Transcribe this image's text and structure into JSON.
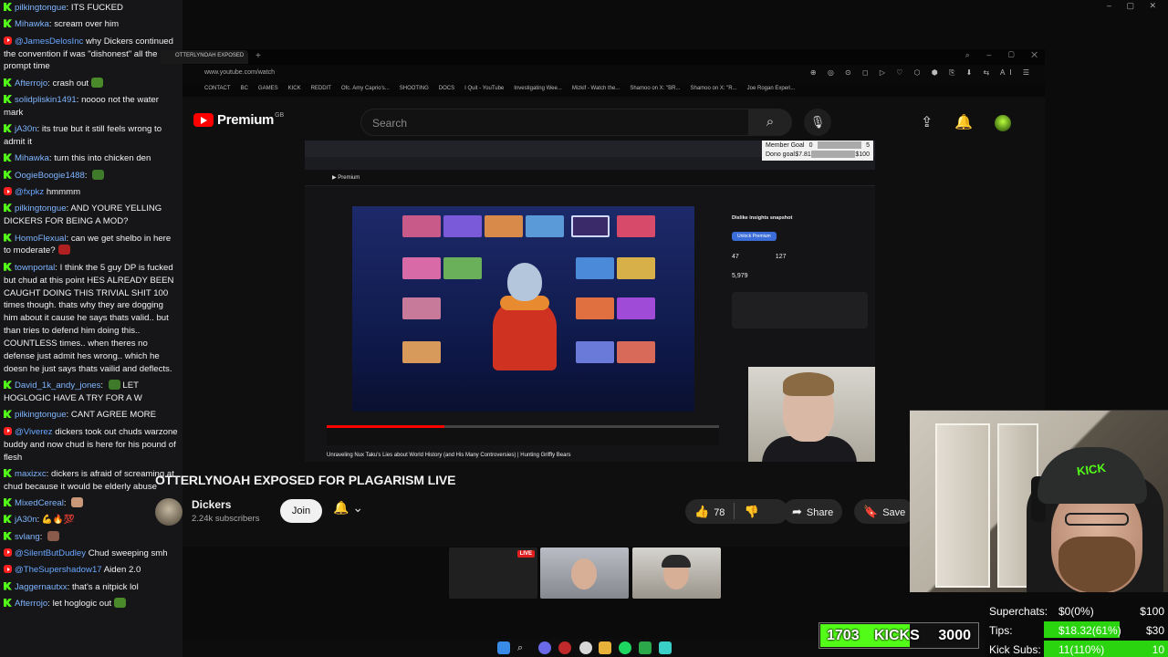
{
  "chat": {
    "messages": [
      {
        "badge": "kick",
        "user": "pilkingtongue",
        "color": "#7fb5ff",
        "text": "ITS FUCKED"
      },
      {
        "badge": "kick",
        "user": "Mihawka",
        "color": "#7fb5ff",
        "text": "scream over him"
      },
      {
        "badge": "yt",
        "user": "@JamesDelosInc",
        "color": "#6aa7ff",
        "text": "why Dickers continued the convention if was \"dishonest\" all the prompt time"
      },
      {
        "badge": "kick",
        "user": "Afterrojo",
        "color": "#7fb5ff",
        "text": "crash out",
        "emote": "#4a8a2a"
      },
      {
        "badge": "kick",
        "user": "solidpliskin1491",
        "color": "#7fb5ff",
        "text": "noooo not the water mark"
      },
      {
        "badge": "kick",
        "user": "jA30n",
        "color": "#7fb5ff",
        "text": "its true but it still feels wrong to admit it"
      },
      {
        "badge": "kick",
        "user": "Mihawka",
        "color": "#7fb5ff",
        "text": "turn this into chicken den"
      },
      {
        "badge": "kick",
        "user": "OogieBoogie1488",
        "color": "#7fb5ff",
        "text": "",
        "emote": "#3e7a2a"
      },
      {
        "badge": "yt",
        "user": "@fxpkz",
        "color": "#6aa7ff",
        "text": "hmmmm"
      },
      {
        "badge": "kick",
        "user": "pilkingtongue",
        "color": "#7fb5ff",
        "text": "AND YOURE YELLING DICKERS FOR BEING A MOD?"
      },
      {
        "badge": "kick",
        "user": "HomoFlexual",
        "color": "#7fb5ff",
        "text": "can we get shelbo in here to moderate?",
        "emote": "#b02020"
      },
      {
        "badge": "kick",
        "user": "townportal",
        "color": "#7fb5ff",
        "text": "I think the 5 guy DP is fucked but chud at this point HES ALREADY BEEN CAUGHT DOING THIS TRIVIAL SHIT 100 times though. thats why they are dogging him about it cause he says thats valid.. but than tries to defend him doing this.. COUNTLESS times.. when theres no defense just admit hes wrong.. which he doesn he just says thats vailid and deflects."
      },
      {
        "badge": "kick",
        "user": "David_1k_andy_jones",
        "color": "#7fb5ff",
        "text": "LET HOGLOGIC HAVE A TRY FOR A W",
        "emote": "#3e7a2a",
        "emote_first": true
      },
      {
        "badge": "kick",
        "user": "pilkingtongue",
        "color": "#7fb5ff",
        "text": "CANT AGREE MORE"
      },
      {
        "badge": "yt",
        "user": "@Viverez",
        "color": "#6aa7ff",
        "text": "dickers took out chuds warzone buddy and now chud is here for his pound of flesh"
      },
      {
        "badge": "kick",
        "user": "maxizxc",
        "color": "#7fb5ff",
        "text": "dickers is afraid of screaming at chud because it would be elderly abuse"
      },
      {
        "badge": "kick",
        "user": "MixedCereal",
        "color": "#7fb5ff",
        "text": "",
        "emote": "#c89878"
      },
      {
        "badge": "kick",
        "user": "jA30n",
        "color": "#7fb5ff",
        "text": "💪🔥💯"
      },
      {
        "badge": "kick",
        "user": "svlang",
        "color": "#7fb5ff",
        "text": "",
        "emote": "#8a5a4a"
      },
      {
        "badge": "yt",
        "user": "@SilentButDudley",
        "color": "#6aa7ff",
        "text": "Chud sweeping smh"
      },
      {
        "badge": "yt",
        "user": "@TheSupershadow17",
        "color": "#6aa7ff",
        "text": "Aiden 2.0"
      },
      {
        "badge": "kick",
        "user": "Jaggernautxx",
        "color": "#7fb5ff",
        "text": "that's a nitpick lol"
      },
      {
        "badge": "kick",
        "user": "Afterrojo",
        "color": "#7fb5ff",
        "text": "let hoglogic out",
        "emote": "#4a8a2a"
      }
    ]
  },
  "browser": {
    "tab_label": "OTTERLYNOAH EXPOSED",
    "url": "www.youtube.com/watch",
    "bookmarks": [
      "CONTACT",
      "BC",
      "GAMES",
      "KICK",
      "REDDIT",
      "Ofc. Amy Caprio's...",
      "SHOOTING",
      "DOCS",
      "I Quit - YouTube",
      "Investigating Wee...",
      "Mizkif - Watch the...",
      "Shamoo on X: \"BR...",
      "Shamoo on X: \"R...",
      "Joe Rogan Experi..."
    ]
  },
  "youtube": {
    "brand": "Premium",
    "region": "GB",
    "search_placeholder": "Search",
    "video_title": "OTTERLYNOAH EXPOSED FOR PLAGARISM LIVE",
    "channel_name": "Dickers",
    "subscribers": "2.24k subscribers",
    "join_label": "Join",
    "likes": "78",
    "share_label": "Share",
    "save_label": "Save",
    "live_badge": "LIVE"
  },
  "inner_video": {
    "goal_member_label": "Member Goal",
    "goal_member_value": "0",
    "goal_member_target": "5",
    "goal_dono_label": "Dono goal",
    "goal_dono_value": "$7.81",
    "goal_dono_target": "$100",
    "side_title": "Dislike insights snapshot",
    "side_button": "Unlock Premium",
    "stat_a": "47",
    "stat_b": "127",
    "stat_c": "5,979",
    "caption": "Unraveling Nux Taku's Lies about World History (and His Many Controversies) | Hunting Griffly Bears"
  },
  "overlay": {
    "kicks_current": "1703",
    "kicks_label": "KICKS",
    "kicks_target": "3000",
    "kicks_progress": 0.568,
    "goals": [
      {
        "name": "Superchats:",
        "value": "$0(0%)",
        "target": "$100",
        "progress": 0.0
      },
      {
        "name": "Tips:",
        "value": "$18.32(61%)",
        "target": "$30",
        "progress": 0.61
      },
      {
        "name": "Kick Subs:",
        "value": "11(110%)",
        "target": "10",
        "progress": 1.0
      }
    ]
  },
  "colors": {
    "kick_green": "#53fc18",
    "yt_red": "#ff0000",
    "goal_green": "#2ad40f"
  }
}
